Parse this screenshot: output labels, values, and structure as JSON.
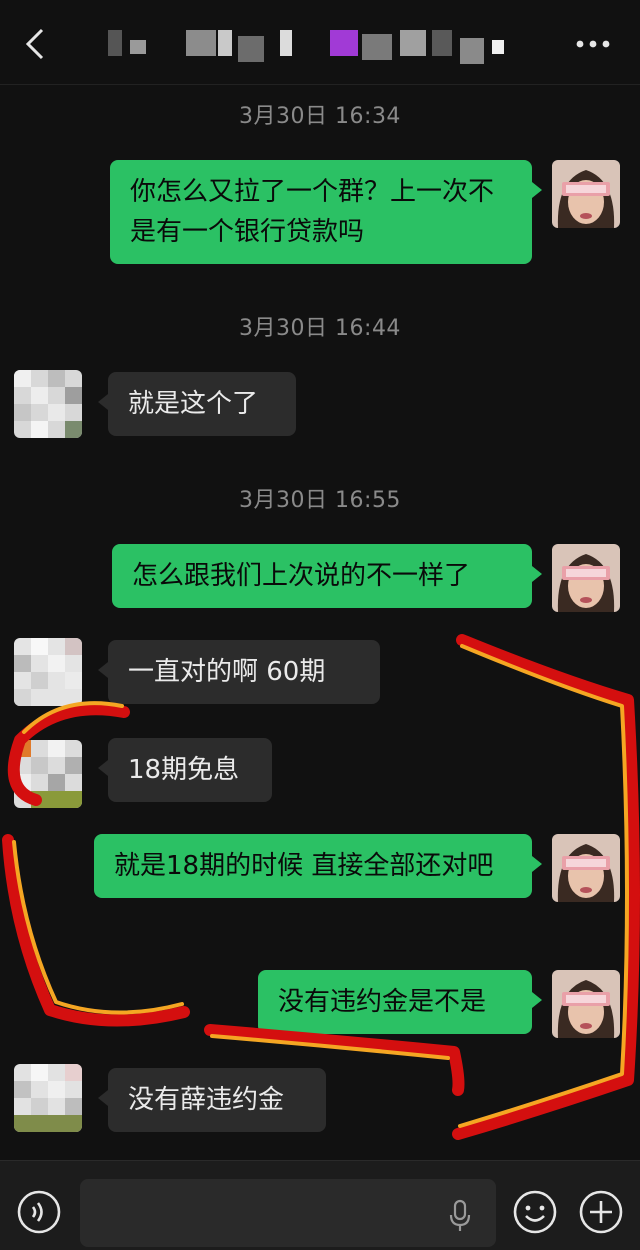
{
  "header": {
    "title": "",
    "back_icon": "chevron-left-icon",
    "more_icon": "more-dots-icon"
  },
  "messages": [
    {
      "type": "timestamp",
      "text": "3月30日 16:34"
    },
    {
      "type": "out",
      "text": "你怎么又拉了一个群？上一次不是有一个银行贷款吗"
    },
    {
      "type": "timestamp",
      "text": "3月30日 16:44"
    },
    {
      "type": "in",
      "text": "就是这个了"
    },
    {
      "type": "timestamp",
      "text": "3月30日 16:55"
    },
    {
      "type": "out",
      "text": "怎么跟我们上次说的不一样了"
    },
    {
      "type": "in",
      "text": "一直对的啊  60期"
    },
    {
      "type": "in",
      "text": "18期免息"
    },
    {
      "type": "out",
      "text": "就是18期的时候 直接全部还对吧"
    },
    {
      "type": "out",
      "text": "没有违约金是不是"
    },
    {
      "type": "in",
      "text": "没有薛违约金"
    }
  ],
  "input_bar": {
    "placeholder": "",
    "voice_icon": "voice-icon",
    "mic_icon": "mic-icon",
    "emoji_icon": "emoji-icon",
    "plus_icon": "plus-icon"
  },
  "colors": {
    "background": "#111111",
    "outgoing_bubble": "#2bc164",
    "incoming_bubble": "#2c2c2c",
    "timestamp": "#8a8a8a",
    "annotation_red": "#d40f0f",
    "annotation_orange": "#f5a623"
  }
}
